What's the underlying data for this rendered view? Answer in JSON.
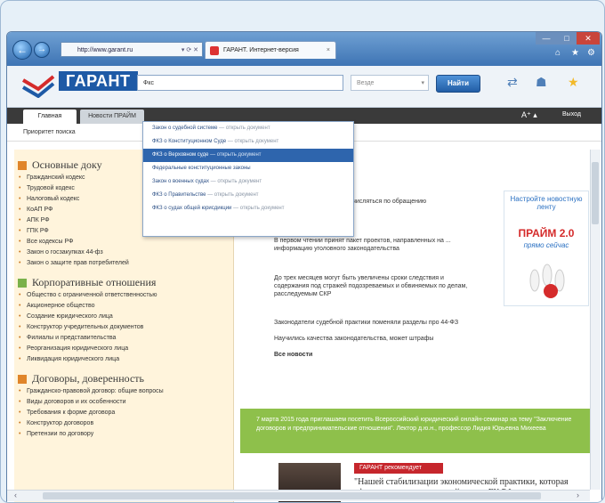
{
  "browser": {
    "address": "http://www.garant.ru",
    "address_controls": "▾ ⟳ ✕",
    "tab_title": "ГАРАНТ. Интернет-версия",
    "tab_close": "×",
    "win_min": "—",
    "win_max": "□",
    "win_close": "✕",
    "back": "←",
    "forward": "→"
  },
  "site": {
    "logo": "ГАРАНТ",
    "search_value": "Фкс",
    "where_placeholder": "Везде",
    "find_button": "Найти",
    "font_size_control": "А⁺ ▴",
    "exit": "Выход"
  },
  "tabs": [
    {
      "label": "Главная"
    },
    {
      "label": "Новости ПРАЙМ"
    }
  ],
  "crumb": "Приоритет поиска",
  "dropdown": [
    {
      "text": "Закон о судебной системе",
      "hint": " — открыть документ"
    },
    {
      "text": "ФКЗ о Конституционном Суде",
      "hint": " — открыть документ"
    },
    {
      "text": "ФКЗ о Верховном суде",
      "hint": " — открыть документ",
      "selected": true
    },
    {
      "text": "Федеральные конституционные законы",
      "hint": ""
    },
    {
      "text": "Закон о военных судах",
      "hint": " — открыть документ"
    },
    {
      "text": "ФКЗ о Правительстве",
      "hint": " — открыть документ"
    },
    {
      "text": "ФКЗ о судах общей юрисдикции",
      "hint": " — открыть документ"
    }
  ],
  "sidebar": {
    "sections": [
      {
        "title": "Основные доку",
        "color": "#e0852a",
        "links": [
          "Гражданский кодекс",
          "Трудовой кодекс",
          "Налоговый кодекс",
          "КоАП РФ",
          "АПК РФ",
          "ГПК РФ",
          "Все кодексы РФ",
          "Закон о госзакупках 44-фз",
          "Закон о защите прав потребителей"
        ]
      },
      {
        "title": "Корпоративные отношения",
        "color": "#7ab14a",
        "links": [
          "Общество с ограниченной ответственностью",
          "Акционерное общество",
          "Создание юридического лица",
          "Конструктор учредительных документов",
          "Филиалы и представительства",
          "Реорганизация юридического лица",
          "Ликвидация юридического лица"
        ]
      },
      {
        "title": "Договоры, доверенность",
        "color": "#e0852a",
        "links": [
          "Гражданско-правовой договор: общие вопросы",
          "Виды договоров и их особенности",
          "Требования к форме договора",
          "Конструктор договоров",
          "Претензии по договору"
        ]
      }
    ]
  },
  "center": {
    "paragraphs": [
      "...обязательных ... могут исчисляться по обращению",
      "В первом чтении принят пакет проектов, направленных на ... информацию уголовного законодательства",
      "До трех месяцев могут быть увеличены сроки следствия и содержания под стражей подозреваемых и обвиняемых по делам, расследуемым СКР",
      "Законодатели судебной практики поменяли разделы про 44-ФЗ",
      "Научились качества законодательства, может штрафы",
      "Все новости"
    ]
  },
  "green_banner": "7 марта 2015 года приглашаем посетить Всероссийский юридический онлайн-семинар на тему \"Заключение договоров и предпринимательские отношения\". Лектор д.ю.н., профессор Лидия Юрьевна Михеева",
  "news": {
    "badge": "ГАРАНТ рекомендует",
    "quote": "\"Нашей стабилизации экономической практики, которая сформировалась под воздействием ГК РФ"
  },
  "ad": {
    "small": "Настройте новостную ленту",
    "big": "ПРАЙМ 2.0",
    "link": "прямо сейчас"
  }
}
